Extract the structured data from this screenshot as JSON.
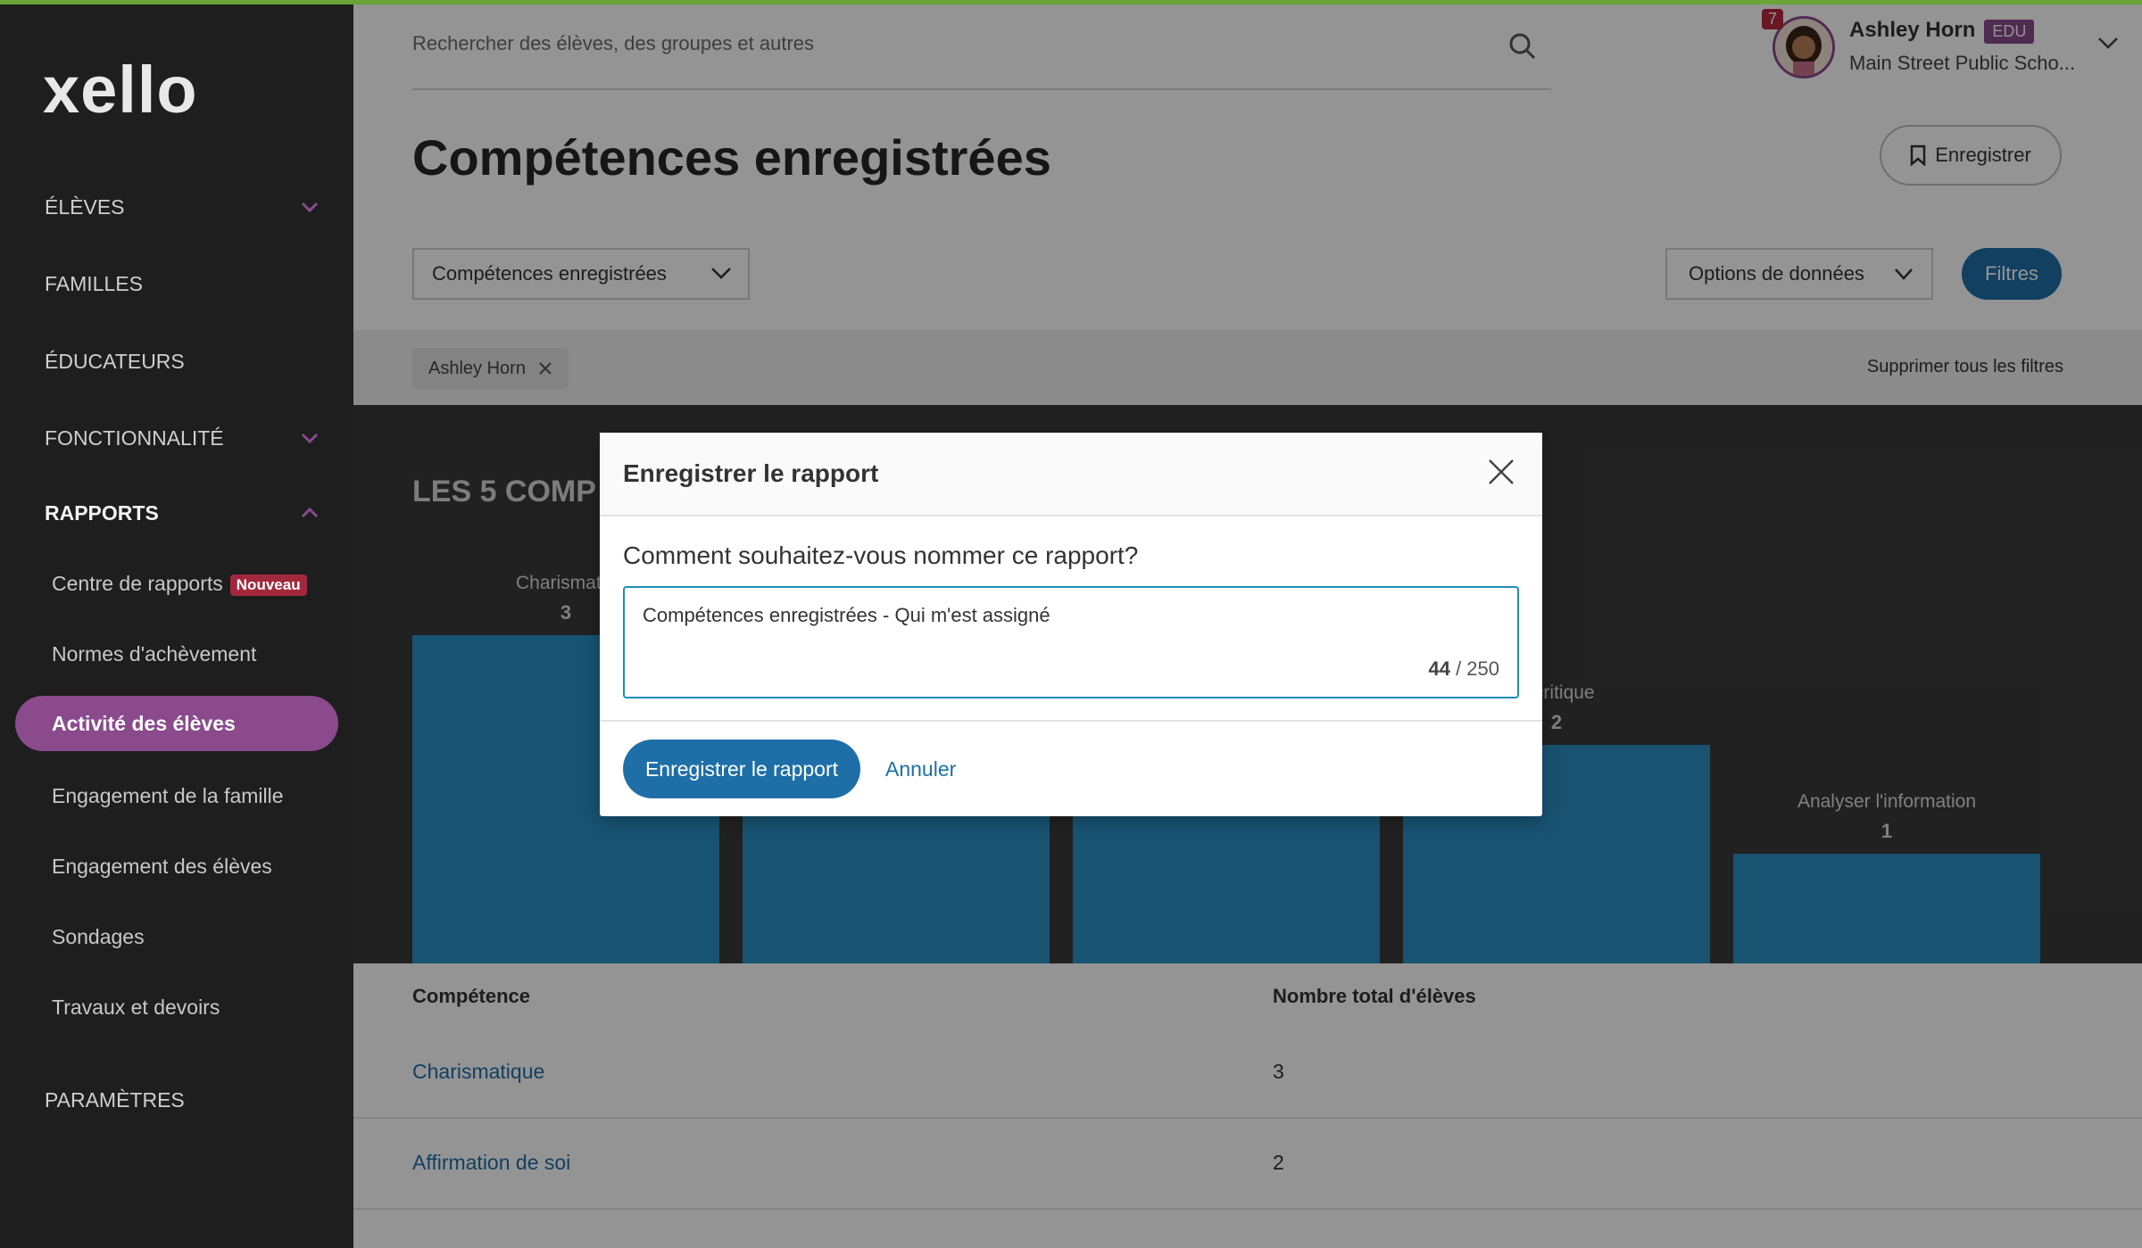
{
  "sidebar": {
    "logo": "xello",
    "items": [
      {
        "label": "ÉLÈVES"
      },
      {
        "label": "FAMILLES"
      },
      {
        "label": "ÉDUCATEURS"
      },
      {
        "label": "FONCTIONNALITÉ"
      },
      {
        "label": "RAPPORTS"
      },
      {
        "label": "PARAMÈTRES"
      }
    ],
    "reports_sub": [
      {
        "label": "Centre de rapports",
        "badge": "Nouveau"
      },
      {
        "label": "Normes d'achèvement"
      },
      {
        "label": "Activité des élèves"
      },
      {
        "label": "Engagement de la famille"
      },
      {
        "label": "Engagement des élèves"
      },
      {
        "label": "Sondages"
      },
      {
        "label": "Travaux et devoirs"
      }
    ]
  },
  "header": {
    "search_placeholder": "Rechercher des élèves, des groupes et autres",
    "notifications": "7",
    "user_name": "Ashley Horn",
    "user_role": "EDU",
    "school": "Main Street Public Scho..."
  },
  "page": {
    "title": "Compétences enregistrées",
    "save_button": "Enregistrer",
    "report_select": "Compétences enregistrées",
    "data_options": "Options de données",
    "filters_button": "Filtres",
    "filter_chip": "Ashley Horn",
    "clear_filters": "Supprimer tous les filtres"
  },
  "chart_data": {
    "type": "bar",
    "title": "LES 5 COMP",
    "categories": [
      "Charismatique",
      "",
      "",
      "critique",
      "Analyser l'information"
    ],
    "values": [
      3,
      null,
      null,
      2,
      1
    ],
    "labels": [
      "Charismatiq",
      "",
      "",
      "e critique",
      "Analyser l'information"
    ],
    "ylim": [
      0,
      3
    ]
  },
  "table": {
    "headers": [
      "Compétence",
      "Nombre total d'élèves"
    ],
    "rows": [
      {
        "skill": "Charismatique",
        "count": "3"
      },
      {
        "skill": "Affirmation de soi",
        "count": "2"
      }
    ]
  },
  "modal": {
    "title": "Enregistrer le rapport",
    "question": "Comment souhaitez-vous nommer ce rapport?",
    "input_value": "Compétences enregistrées - Qui m'est assigné",
    "count": "44",
    "max": "/ 250",
    "primary": "Enregistrer le rapport",
    "cancel": "Annuler"
  },
  "colors": {
    "sidebar": "#1e1e1e",
    "accent_purple": "#8a4a8c",
    "primary_blue": "#1e6fa8",
    "bar_blue": "#2a90c4",
    "top_line_green": "#6aa437"
  }
}
